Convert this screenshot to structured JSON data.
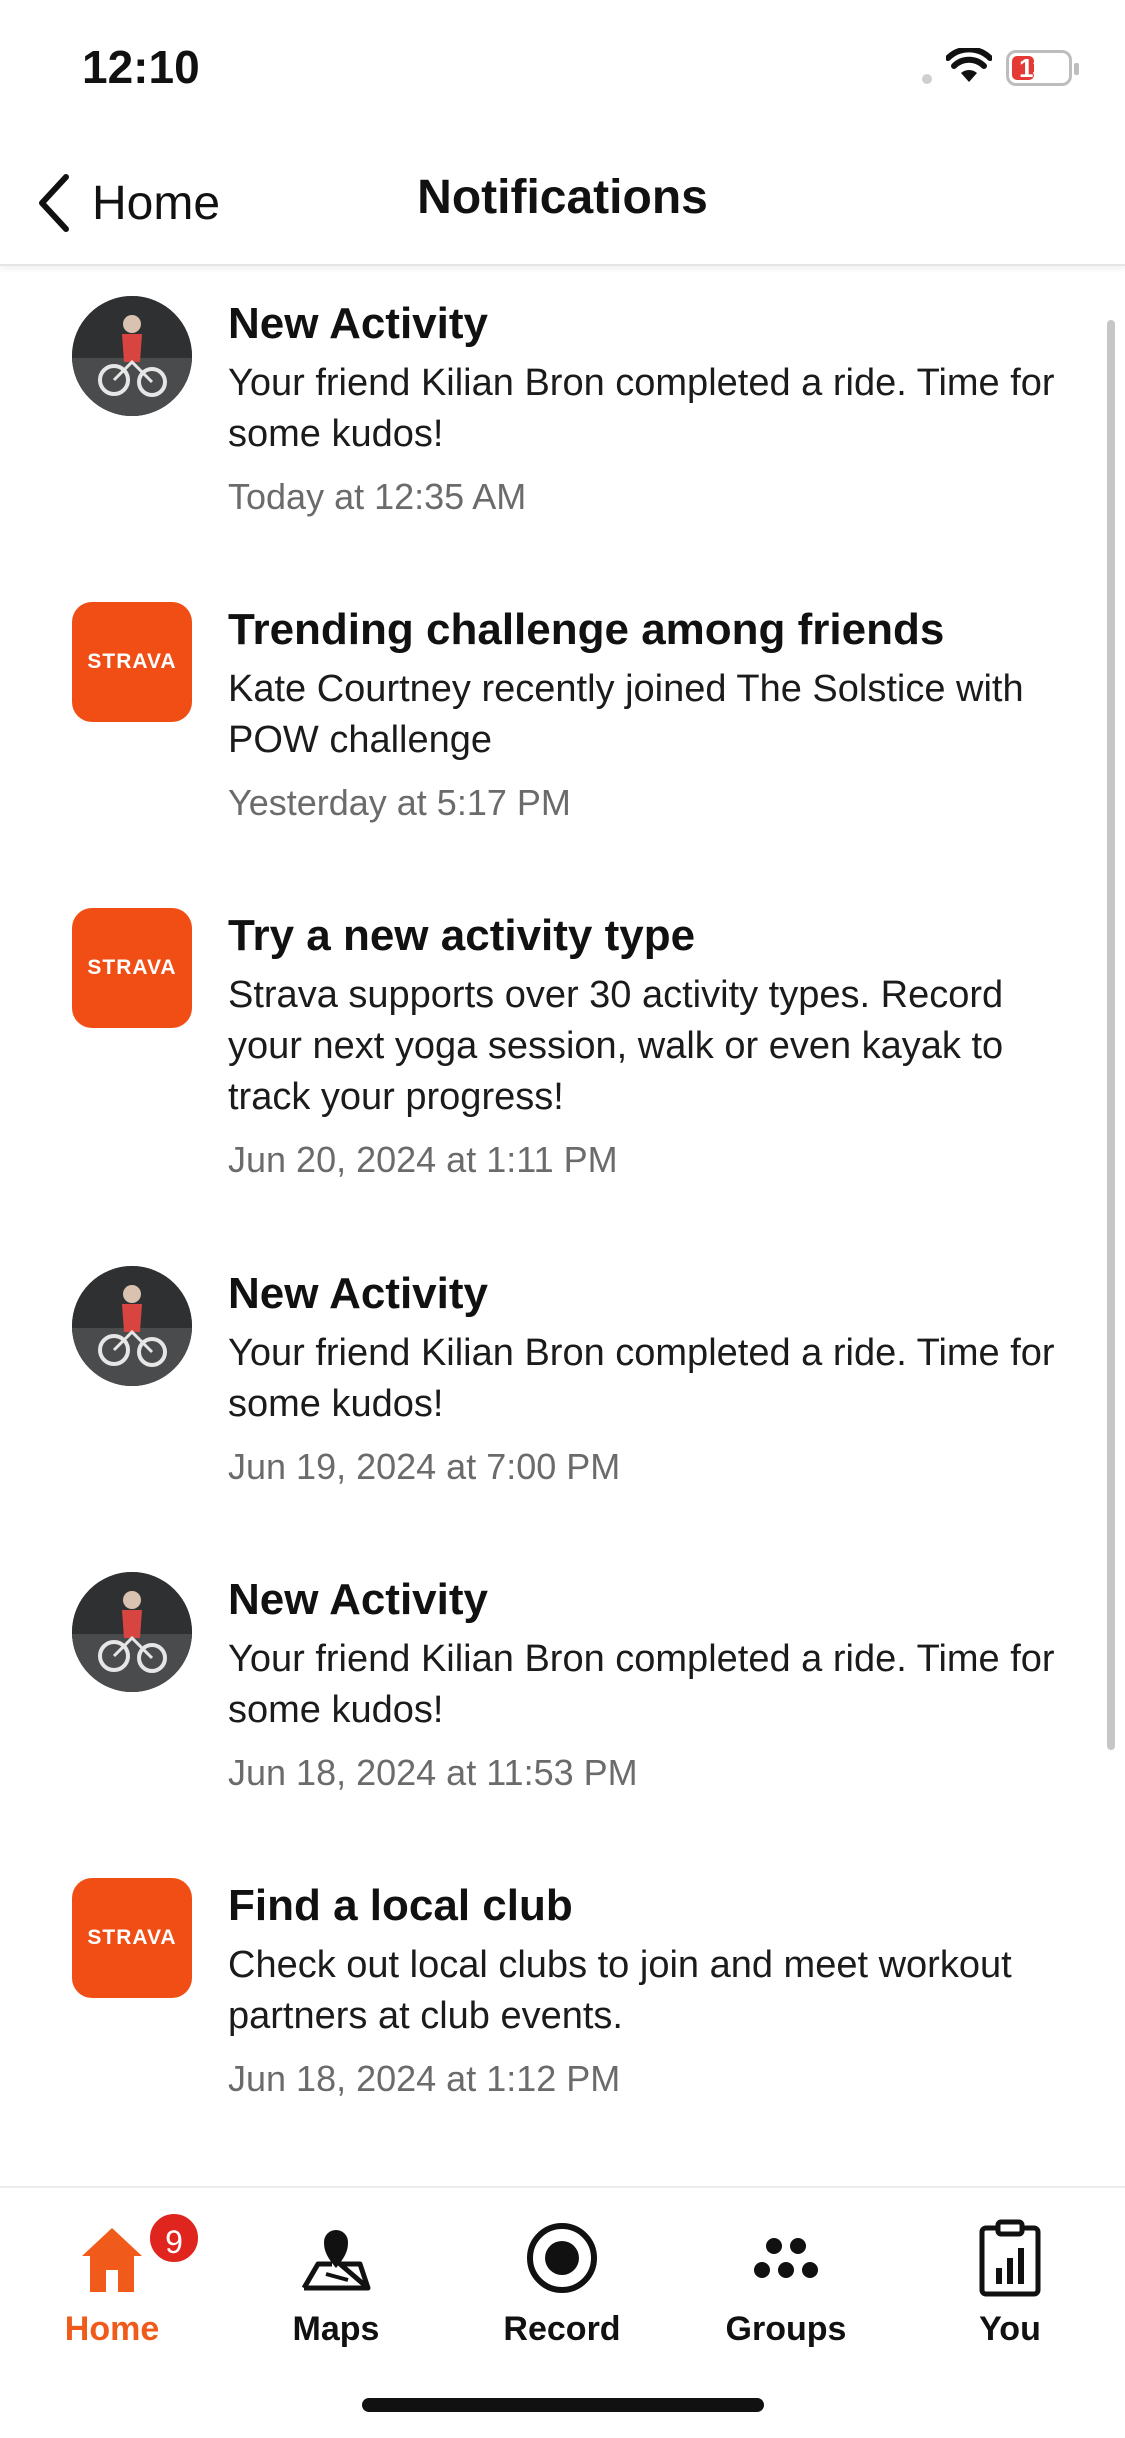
{
  "status_bar": {
    "time": "12:10",
    "battery": "13"
  },
  "header": {
    "back_label": "Home",
    "title": "Notifications"
  },
  "notifications": [
    {
      "icon": "avatar",
      "title": "New Activity",
      "body": "Your friend Kilian Bron completed a ride. Time for some kudos!",
      "date": "Today at 12:35 AM"
    },
    {
      "icon": "strava-logo",
      "title": "Trending challenge among friends",
      "body": "Kate Courtney recently joined The Solstice with POW challenge",
      "date": "Yesterday at 5:17 PM"
    },
    {
      "icon": "strava-logo",
      "title": "Try a new activity type",
      "body": "Strava supports over 30 activity types. Record your next yoga session, walk or even kayak to track your progress!",
      "date": "Jun 20, 2024 at 1:11 PM"
    },
    {
      "icon": "avatar",
      "title": "New Activity",
      "body": "Your friend Kilian Bron completed a ride. Time for some kudos!",
      "date": "Jun 19, 2024 at 7:00 PM"
    },
    {
      "icon": "avatar",
      "title": "New Activity",
      "body": "Your friend Kilian Bron completed a ride. Time for some kudos!",
      "date": "Jun 18, 2024 at 11:53 PM"
    },
    {
      "icon": "strava-logo",
      "title": "Find a local club",
      "body": "Check out local clubs to join and meet workout partners at club events.",
      "date": "Jun 18, 2024 at 1:12 PM"
    }
  ],
  "brand_text": "STRAVA",
  "tabbar": {
    "home": {
      "label": "Home",
      "badge": "9"
    },
    "maps": {
      "label": "Maps"
    },
    "record": {
      "label": "Record"
    },
    "groups": {
      "label": "Groups"
    },
    "you": {
      "label": "You"
    }
  },
  "colors": {
    "accent": "#f05a1a",
    "brand": "#f04e15",
    "badge": "#e0251f"
  }
}
